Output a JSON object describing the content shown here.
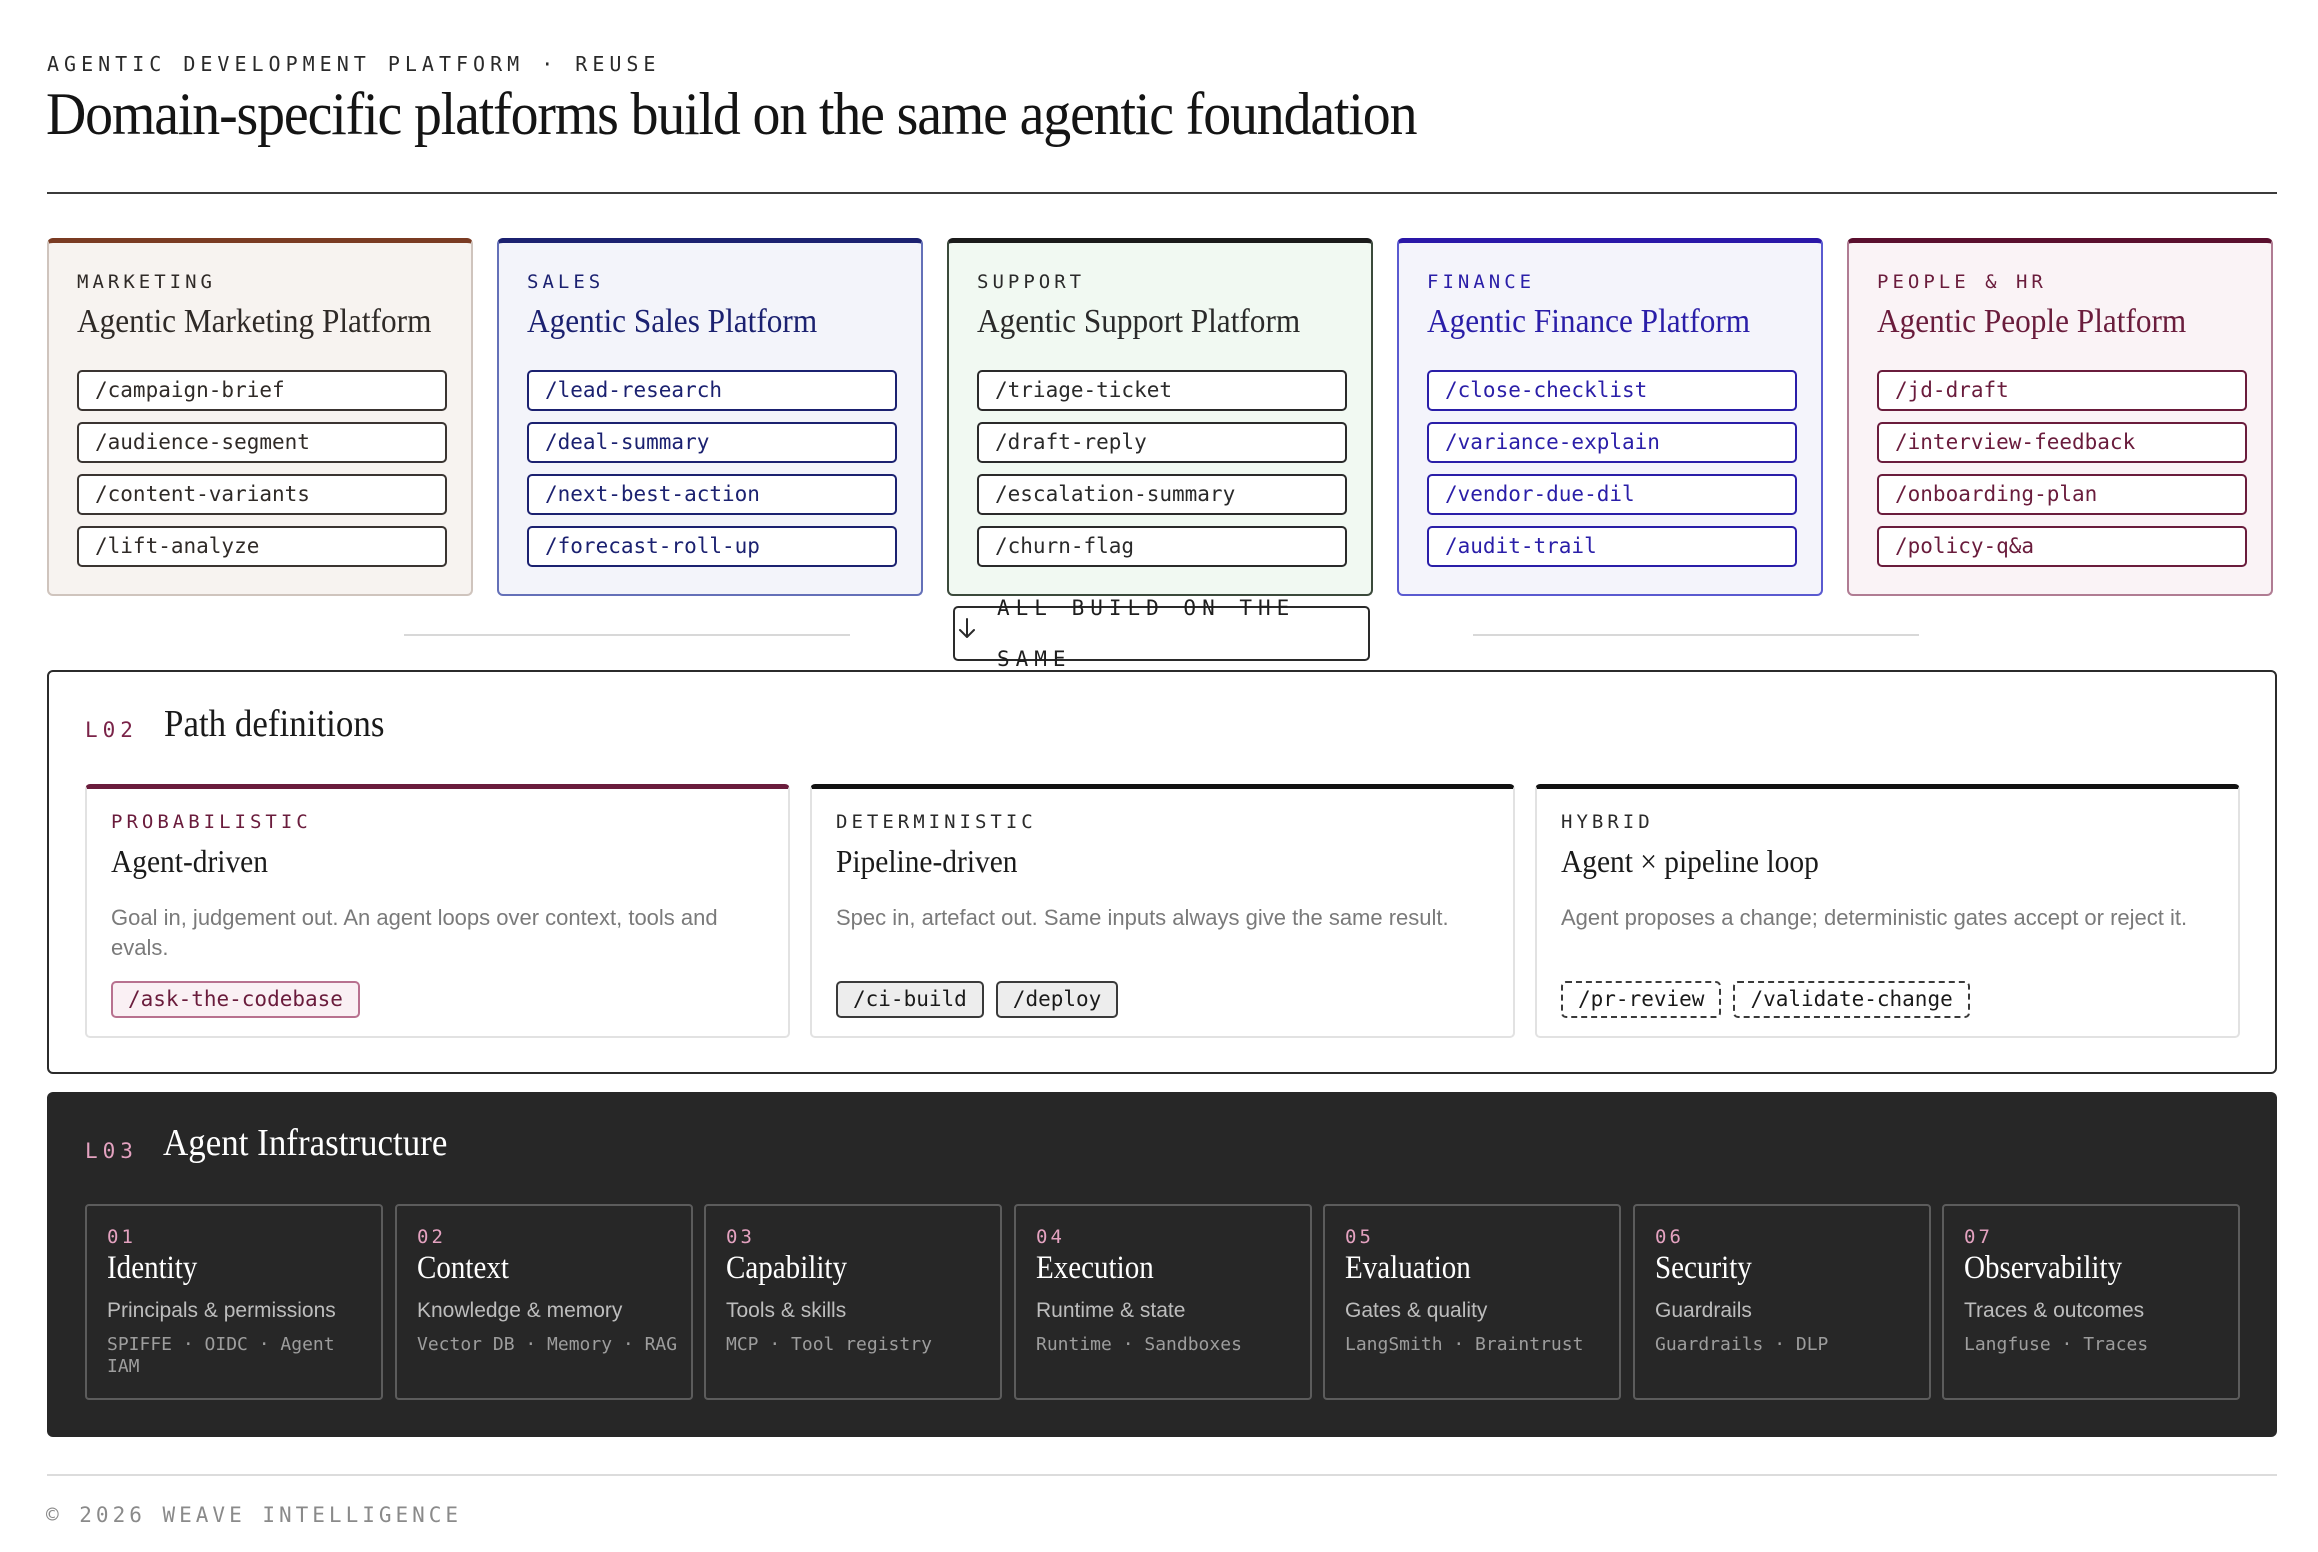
{
  "header": {
    "eyebrow": "AGENTIC DEVELOPMENT PLATFORM · REUSE",
    "title": "Domain-specific platforms build on the same agentic foundation"
  },
  "platforms": [
    {
      "kicker": "MARKETING",
      "title": "Agentic Marketing Platform",
      "commands": [
        "/campaign-brief",
        "/audience-segment",
        "/content-variants",
        "/lift-analyze"
      ],
      "colors": {
        "accent": "#7a3b22",
        "bg": "#f7f3f0",
        "border": "#cfc4bd",
        "chip_border": "#3a3431",
        "text": "#2f2a27"
      }
    },
    {
      "kicker": "SALES",
      "title": "Agentic Sales Platform",
      "commands": [
        "/lead-research",
        "/deal-summary",
        "/next-best-action",
        "/forecast-roll-up"
      ],
      "colors": {
        "accent": "#1b2170",
        "bg": "#f3f4fa",
        "border": "#6470b8",
        "chip_border": "#1b2170",
        "text": "#1b2170"
      }
    },
    {
      "kicker": "SUPPORT",
      "title": "Agentic Support Platform",
      "commands": [
        "/triage-ticket",
        "/draft-reply",
        "/escalation-summary",
        "/churn-flag"
      ],
      "colors": {
        "accent": "#1b1b1b",
        "bg": "#f1f9f2",
        "border": "#3b4a3b",
        "chip_border": "#2a2a2a",
        "text": "#2a2a2a"
      }
    },
    {
      "kicker": "FINANCE",
      "title": "Agentic Finance Platform",
      "commands": [
        "/close-checklist",
        "/variance-explain",
        "/vendor-due-dil",
        "/audit-trail"
      ],
      "colors": {
        "accent": "#2a17a8",
        "bg": "#f4f4fb",
        "border": "#5a5ad0",
        "chip_border": "#2a1ea8",
        "text": "#2a1ea8"
      }
    },
    {
      "kicker": "PEOPLE & HR",
      "title": "Agentic People Platform",
      "commands": [
        "/jd-draft",
        "/interview-feedback",
        "/onboarding-plan",
        "/policy-q&a"
      ],
      "colors": {
        "accent": "#5a0f2e",
        "bg": "#faf3f6",
        "border": "#b07c93",
        "chip_border": "#6a1c3c",
        "text": "#6a1c3c"
      }
    }
  ],
  "connector": {
    "label": "ALL BUILD ON THE SAME",
    "icon": "arrow-down-icon"
  },
  "paths_layer": {
    "number": "L02",
    "title": "Path definitions",
    "cards": [
      {
        "kicker": "PROBABILISTIC",
        "title": "Agent-driven",
        "description": "Goal in, judgement out. An agent loops over context, tools and evals.",
        "tags": [
          "/ask-the-codebase"
        ],
        "colors": {
          "accent": "#6a1c3c",
          "kicker": "#6a1c3c",
          "tag_style": "pink"
        }
      },
      {
        "kicker": "DETERMINISTIC",
        "title": "Pipeline-driven",
        "description": "Spec in, artefact out. Same inputs always give the same result.",
        "tags": [
          "/ci-build",
          "/deploy"
        ],
        "colors": {
          "accent": "#111111",
          "kicker": "#2a2a2a",
          "tag_style": "gray"
        }
      },
      {
        "kicker": "HYBRID",
        "title": "Agent × pipeline loop",
        "description": "Agent proposes a change; deterministic gates accept or reject it.",
        "tags": [
          "/pr-review",
          "/validate-change"
        ],
        "colors": {
          "accent": "#111111",
          "kicker": "#2a2a2a",
          "tag_style": "dashed"
        }
      }
    ]
  },
  "infra_layer": {
    "number": "L03",
    "title": "Agent Infrastructure",
    "items": [
      {
        "num": "01",
        "title": "Identity",
        "subtitle": "Principals & permissions",
        "tools": "SPIFFE · OIDC · Agent IAM"
      },
      {
        "num": "02",
        "title": "Context",
        "subtitle": "Knowledge & memory",
        "tools": "Vector DB · Memory · RAG"
      },
      {
        "num": "03",
        "title": "Capability",
        "subtitle": "Tools & skills",
        "tools": "MCP · Tool registry"
      },
      {
        "num": "04",
        "title": "Execution",
        "subtitle": "Runtime & state",
        "tools": "Runtime · Sandboxes"
      },
      {
        "num": "05",
        "title": "Evaluation",
        "subtitle": "Gates & quality",
        "tools": "LangSmith · Braintrust"
      },
      {
        "num": "06",
        "title": "Security",
        "subtitle": "Guardrails",
        "tools": "Guardrails · DLP"
      },
      {
        "num": "07",
        "title": "Observability",
        "subtitle": "Traces & outcomes",
        "tools": "Langfuse · Traces"
      }
    ]
  },
  "footer": {
    "text": "© 2026 WEAVE INTELLIGENCE"
  }
}
